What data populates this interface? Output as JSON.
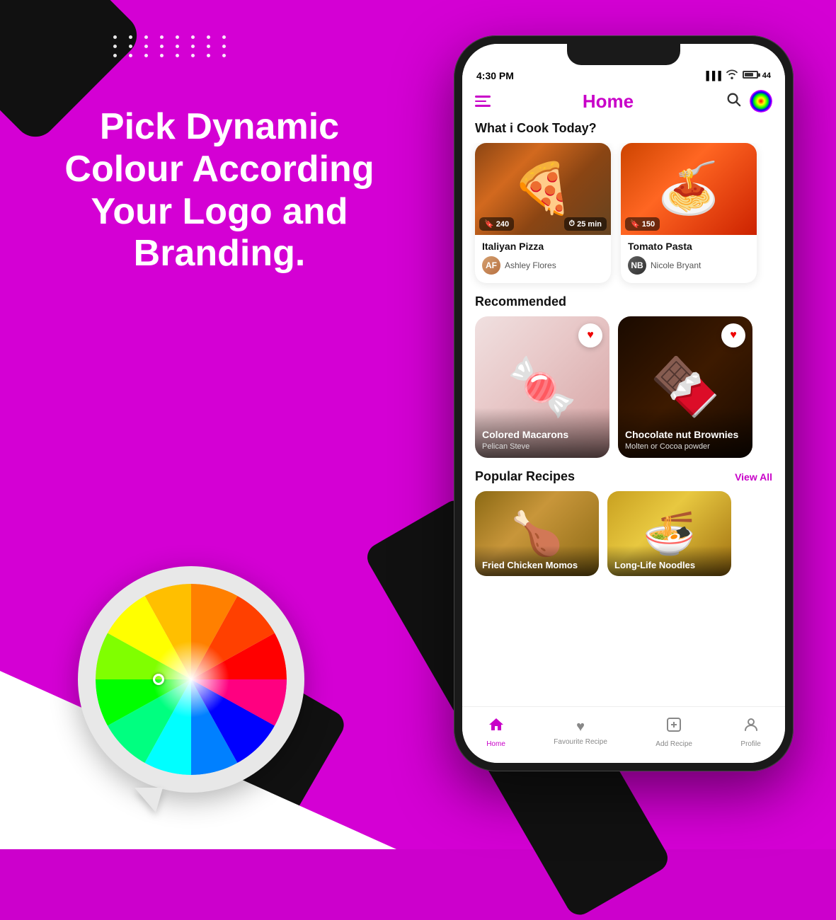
{
  "background": {
    "color": "#d400d4"
  },
  "left_panel": {
    "headline_line1": "Pick Dynamic",
    "headline_line2": "Colour According",
    "headline_line3": "Your Logo and Branding."
  },
  "status_bar": {
    "time": "4:30 PM",
    "battery": "44"
  },
  "app_header": {
    "title": "Home",
    "menu_icon": "hamburger-menu",
    "search_icon": "search",
    "palette_icon": "color-palette"
  },
  "sections": {
    "what_i_cook": {
      "title": "What i Cook Today?",
      "recipes": [
        {
          "name": "Italiyan Pizza",
          "author": "Ashley Flores",
          "calories": "240",
          "time": "25 min",
          "image_type": "pizza"
        },
        {
          "name": "Tomato Pasta",
          "author": "Nicole Bryant",
          "calories": "150",
          "time": "",
          "image_type": "tomato-pasta"
        }
      ]
    },
    "recommended": {
      "title": "Recommended",
      "items": [
        {
          "title": "Colored Macarons",
          "subtitle": "Pelican Steve",
          "image_type": "macarons",
          "liked": true
        },
        {
          "title": "Chocolate nut Brownies",
          "subtitle": "Molten or Cocoa powder",
          "image_type": "brownies",
          "liked": true
        }
      ]
    },
    "popular_recipes": {
      "title": "Popular Recipes",
      "view_all": "View All",
      "items": [
        {
          "name": "Fried Chicken Momos",
          "image_type": "chicken"
        },
        {
          "name": "Long-Life Noodles",
          "image_type": "noodles"
        }
      ]
    }
  },
  "bottom_nav": {
    "items": [
      {
        "label": "Home",
        "icon": "home",
        "active": true
      },
      {
        "label": "Favourite Recipe",
        "icon": "heart",
        "active": false
      },
      {
        "label": "Add Recipe",
        "icon": "plus-square",
        "active": false
      },
      {
        "label": "Profile",
        "icon": "user",
        "active": false
      }
    ]
  }
}
